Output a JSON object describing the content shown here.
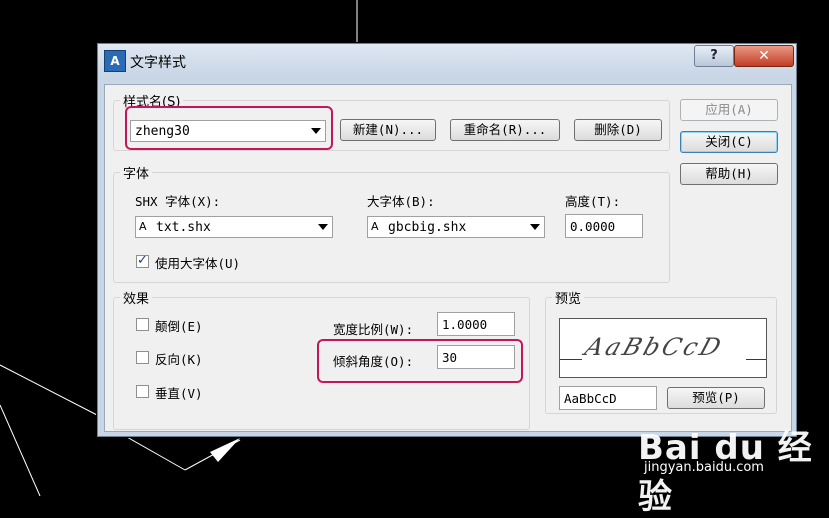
{
  "dialog": {
    "title": "文字样式",
    "help_btn": "?",
    "close_btn": "✕"
  },
  "style_group": {
    "legend": "样式名(S)",
    "selected": "zheng30",
    "new_btn": "新建(N)...",
    "rename_btn": "重命名(R)...",
    "delete_btn": "删除(D)"
  },
  "side_buttons": {
    "apply": "应用(A)",
    "close": "关闭(C)",
    "help": "帮助(H)"
  },
  "font_group": {
    "legend": "字体",
    "shx_label": "SHX 字体(X):",
    "shx_value": "txt.shx",
    "bigfont_label": "大字体(B):",
    "bigfont_value": "gbcbig.shx",
    "height_label": "高度(T):",
    "height_value": "0.0000",
    "use_bigfont_label": "使用大字体(U)",
    "use_bigfont_checked": true
  },
  "effects_group": {
    "legend": "效果",
    "upside_down": "颠倒(E)",
    "backwards": "反向(K)",
    "vertical": "垂直(V)",
    "width_factor_label": "宽度比例(W):",
    "width_factor_value": "1.0000",
    "oblique_label": "倾斜角度(O):",
    "oblique_value": "30"
  },
  "preview_group": {
    "legend": "预览",
    "sample_text": "AaBbCcD",
    "input_value": "AaBbCcD",
    "preview_btn": "预览(P)"
  },
  "watermark": {
    "logo": "Bai du 经验",
    "url": "jingyan.baidu.com"
  },
  "colors": {
    "highlight": "#c2185b",
    "canvas": "#000000"
  }
}
